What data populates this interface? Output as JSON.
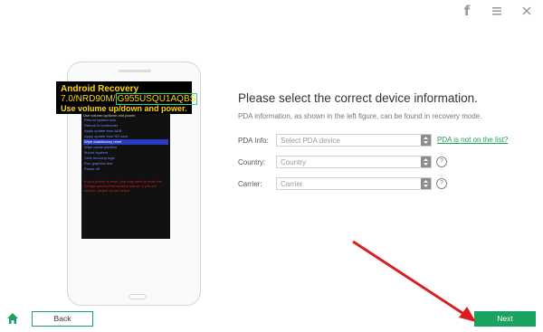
{
  "titlebar": {
    "facebook_icon": "facebook-icon",
    "menu_icon": "menu-icon",
    "close_icon": "close-icon",
    "fb_glyph": "f"
  },
  "phone_callout": {
    "title": "Android Recovery",
    "version": "7.0/NRD90M/",
    "model": "G955USQU1AQBS",
    "instruction": "Use volume up/down and power."
  },
  "phone_screen": {
    "header": "Use volume up/down and power.",
    "items": [
      "Reboot system now",
      "Reboot to bootloader",
      "Apply update from ADB",
      "Apply update from SD card",
      "Wipe data/factory reset",
      "Wipe cache partition",
      "Mount /system",
      "View recovery logs",
      "Run graphics test",
      "Power off"
    ],
    "selected_index": 4,
    "warning": "If your phone is reset, you may need to enter the Google account information stored. If you are unsure, please do not select."
  },
  "main": {
    "heading": "Please select the correct device information.",
    "subtext": "PDA information, as shown in the left figure, can be found in recovery mode.",
    "pda_label": "PDA Info:",
    "pda_placeholder": "Select PDA device",
    "pda_link": "PDA is not on the list?",
    "country_label": "Country:",
    "country_placeholder": "Country",
    "carrier_label": "Carrier:",
    "carrier_placeholder": "Carrier",
    "help_glyph": "?"
  },
  "footer": {
    "back_label": "Back",
    "next_label": "Next",
    "home_icon": "home-icon"
  },
  "colors": {
    "accent": "#1aa260",
    "arrow": "#d81e1e",
    "callout_text": "#ffd700"
  }
}
